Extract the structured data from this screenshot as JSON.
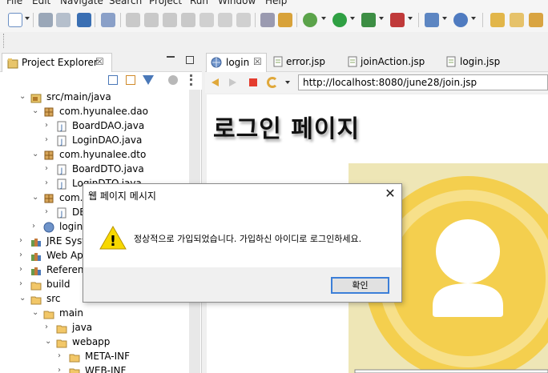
{
  "menubar": {
    "items": [
      "File",
      "Edit",
      "Navigate",
      "Search",
      "Project",
      "Run",
      "Window",
      "Help"
    ]
  },
  "project_explorer": {
    "title": "Project Explorer",
    "close_glyph": "☒",
    "tree": [
      {
        "label": "src/main/java",
        "expanded": true,
        "icon": "package-folder-icon"
      },
      {
        "label": "com.hyunalee.dao",
        "expanded": true,
        "icon": "package-icon"
      },
      {
        "label": "BoardDAO.java",
        "icon": "java-file-icon"
      },
      {
        "label": "LoginDAO.java",
        "icon": "java-file-icon"
      },
      {
        "label": "com.hyunalee.dto",
        "expanded": true,
        "icon": "package-icon"
      },
      {
        "label": "BoardDTO.java",
        "icon": "java-file-icon"
      },
      {
        "label": "LoginDTO.java",
        "icon": "java-file-icon"
      },
      {
        "label": "com.",
        "expanded": true,
        "icon": "package-icon"
      },
      {
        "label": "DE",
        "icon": "java-file-icon"
      },
      {
        "label": "login.",
        "icon": "jsp-file-icon"
      },
      {
        "label": "JRE Syste",
        "icon": "library-icon"
      },
      {
        "label": "Web App",
        "icon": "library-icon"
      },
      {
        "label": "Referenc",
        "icon": "library-icon"
      },
      {
        "label": "build",
        "icon": "folder-icon"
      },
      {
        "label": "src",
        "expanded": true,
        "icon": "folder-icon"
      },
      {
        "label": "main",
        "expanded": true,
        "icon": "folder-icon"
      },
      {
        "label": "java",
        "icon": "folder-icon"
      },
      {
        "label": "webapp",
        "expanded": true,
        "icon": "folder-icon"
      },
      {
        "label": "META-INF",
        "icon": "folder-icon"
      },
      {
        "label": "WEB-INF",
        "icon": "folder-icon"
      }
    ]
  },
  "editor": {
    "tabs": [
      {
        "label": "login",
        "active": true,
        "close_glyph": "☒"
      },
      {
        "label": "error.jsp"
      },
      {
        "label": "joinAction.jsp"
      },
      {
        "label": "login.jsp"
      }
    ],
    "url": "http://localhost:8080/june28/join.jsp",
    "page_heading": "로그인 페이지"
  },
  "dialog": {
    "title": "웹 페이지 메시지",
    "message": "정상적으로 가입되었습니다. 가입하신 아이디로 로그인하세요.",
    "ok_label": "확인",
    "close_glyph": "✕",
    "warning_glyph": "!"
  },
  "colors": {
    "avatar_bg": "#eee6b6",
    "avatar_ring": "#f4cf4e",
    "avatar_ring_light": "#f7e08a",
    "warning": "#f7d800",
    "dialog_focus": "#3c7fd8"
  }
}
